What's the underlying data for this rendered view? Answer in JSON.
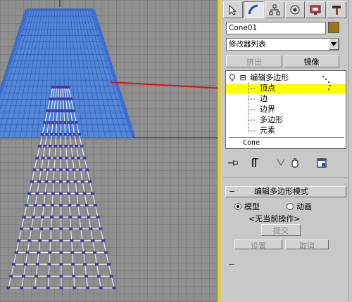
{
  "viewport": {
    "label": "viewport-perspective",
    "arrow_color": "#e01010",
    "wire_color": "#5b8fe0",
    "vertex_color": "#3a3aa8"
  },
  "panel": {
    "tabs": [
      "create",
      "modify",
      "hierarchy",
      "motion",
      "display",
      "utilities"
    ],
    "object_name": "Cone01",
    "swatch_color": "#9c7410",
    "modifier_list": "修改器列表",
    "extrude_label": "挤出",
    "mirror_label": "镜像",
    "stack": {
      "root_label": "编辑多边形",
      "expand_sign": "⊟",
      "items": [
        "顶点",
        "边",
        "边界",
        "多边形",
        "元素"
      ],
      "base_object": "Cone",
      "highlight_color": "#ffff00"
    },
    "rollout": {
      "title": "编辑多边形模式",
      "radio_model": "模型",
      "radio_anim": "动画",
      "no_op": "<无当前操作>",
      "commit": "提交",
      "settings": "设置",
      "cancel": "取消"
    }
  }
}
